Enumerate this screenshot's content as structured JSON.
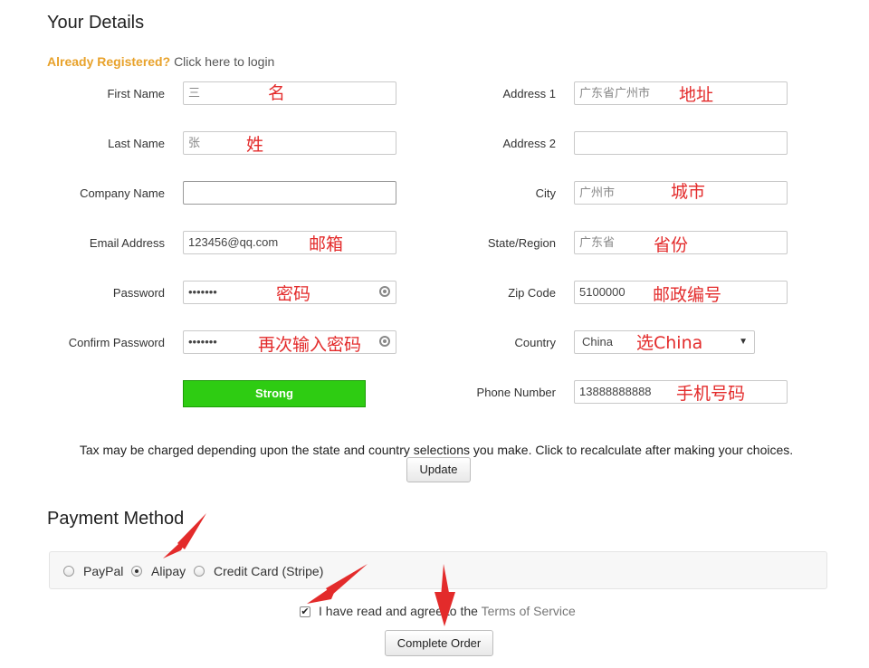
{
  "details": {
    "title": "Your Details",
    "already_registered": "Already Registered?",
    "login_link": "Click here to login"
  },
  "form": {
    "first_name": {
      "label": "First Name",
      "value": "三",
      "note": "名"
    },
    "last_name": {
      "label": "Last Name",
      "value": "张",
      "note": "姓"
    },
    "company_name": {
      "label": "Company Name",
      "value": ""
    },
    "email": {
      "label": "Email Address",
      "value": "123456@qq.com",
      "note": "邮箱"
    },
    "password": {
      "label": "Password",
      "value": "•••••••",
      "note": "密码"
    },
    "confirm_password": {
      "label": "Confirm Password",
      "value": "•••••••",
      "note": "再次输入密码"
    },
    "strength": "Strong",
    "address1": {
      "label": "Address 1",
      "value": "广东省广州市",
      "note": "地址"
    },
    "address2": {
      "label": "Address 2",
      "value": ""
    },
    "city": {
      "label": "City",
      "value": "广州市",
      "note": "城市"
    },
    "state": {
      "label": "State/Region",
      "value": "广东省",
      "note": "省份"
    },
    "zip": {
      "label": "Zip Code",
      "value": "5100000",
      "note": "邮政编号"
    },
    "country": {
      "label": "Country",
      "value": "China",
      "note": "选China"
    },
    "phone": {
      "label": "Phone Number",
      "value": "13888888888",
      "note": "手机号码"
    }
  },
  "tax": {
    "text": "Tax may be charged depending upon the state and country selections you make. Click to recalculate after making your choices.",
    "update_label": "Update"
  },
  "payment": {
    "title": "Payment Method",
    "options": [
      "PayPal",
      "Alipay",
      "Credit Card (Stripe)"
    ],
    "selected": "Alipay"
  },
  "terms": {
    "text_before": "I have read and agree to the",
    "link": "Terms of Service"
  },
  "complete_label": "Complete Order",
  "colors": {
    "accent": "#e8a22b",
    "strength": "#2ecc12",
    "annotation": "#e32b2b"
  }
}
